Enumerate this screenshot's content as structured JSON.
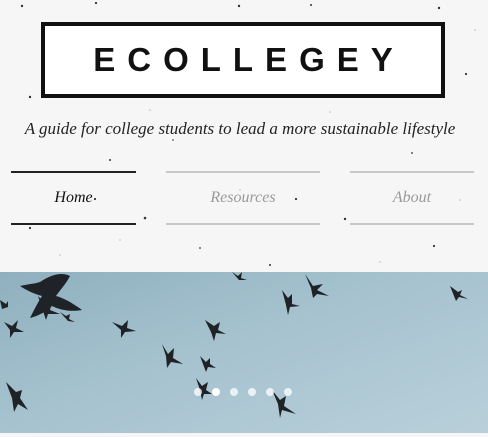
{
  "header": {
    "logo": "ECOLLEGEY",
    "tagline": "A guide for college students to lead a more sustainable lifestyle"
  },
  "nav": {
    "items": [
      {
        "label": "Home",
        "active": true
      },
      {
        "label": "Resources",
        "active": false
      },
      {
        "label": "About",
        "active": false
      }
    ]
  },
  "hero": {
    "image": "flock-of-birds-in-sky",
    "slide_count": 6,
    "active_slide": 1
  },
  "colors": {
    "background": "#f6f6f6",
    "text": "#111111",
    "nav_inactive": "#9a9a9a",
    "sky": "#a6c2cf"
  }
}
